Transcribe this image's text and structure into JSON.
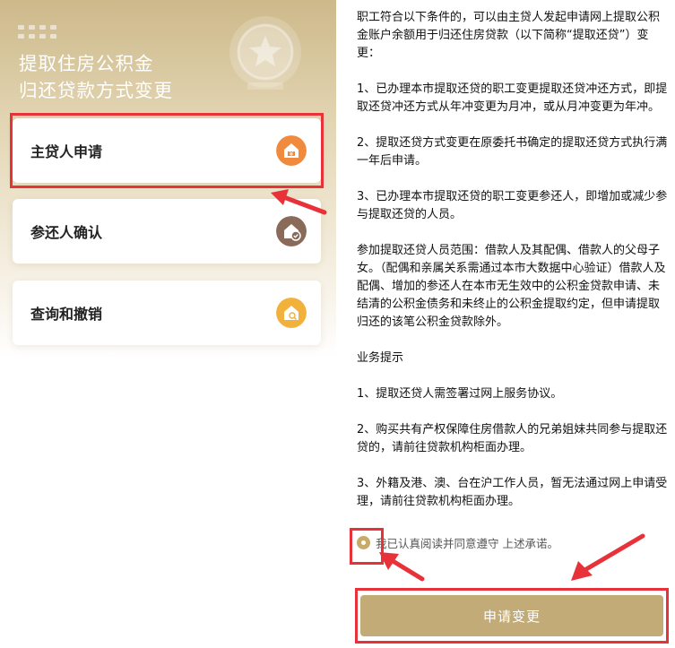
{
  "left_panel": {
    "banner_title_line1": "提取住房公积金",
    "banner_title_line2": "归还贷款方式变更",
    "menu": [
      {
        "label": "主贷人申请",
        "icon": "house-money-icon"
      },
      {
        "label": "参还人确认",
        "icon": "house-check-icon"
      },
      {
        "label": "查询和撤销",
        "icon": "house-search-icon"
      }
    ]
  },
  "right_panel": {
    "paragraphs": [
      "职工符合以下条件的，可以由主贷人发起申请网上提取公积金账户余额用于归还住房贷款（以下简称“提取还贷”）变更：",
      "1、已办理本市提取还贷的职工变更提取还贷冲还方式，即提取还贷冲还方式从年冲变更为月冲，或从月冲变更为年冲。",
      "2、提取还贷方式变更在原委托书确定的提取还贷方式执行满一年后申请。",
      "3、已办理本市提取还贷的职工变更参还人，即增加或减少参与提取还贷的人员。",
      "参加提取还贷人员范围：借款人及其配偶、借款人的父母子女。（配偶和亲属关系需通过本市大数据中心验证）借款人及配偶、增加的参还人在本市无生效中的公积金贷款申请、未结清的公积金债务和未终止的公积金提取约定，但申请提取归还的该笔公积金贷款除外。",
      "业务提示",
      "1、提取还贷人需签署过网上服务协议。",
      "2、购买共有产权保障住房借款人的兄弟姐妹共同参与提取还贷的，请前往贷款机构柜面办理。",
      "3、外籍及港、澳、台在沪工作人员，暂无法通过网上申请受理，请前往贷款机构柜面办理。"
    ],
    "agree_text": "我已认真阅读并同意遵守 上述承诺。",
    "submit_label": "申请变更"
  },
  "colors": {
    "accent_gold": "#c3ab78",
    "highlight_red": "#e8323a",
    "icon_orange": "#f08a3c",
    "icon_brown": "#8a6a58",
    "icon_yellow": "#f2b13a"
  }
}
